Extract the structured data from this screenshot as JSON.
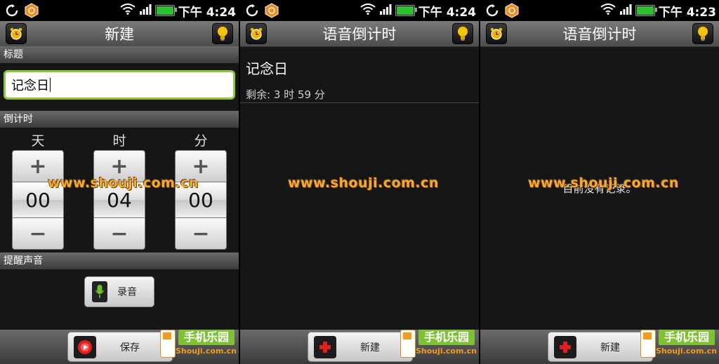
{
  "status": {
    "panel1_time": "下午 4:24",
    "panel2_time": "下午 4:24",
    "panel3_time": "下午 4:23",
    "battery_color": "#2ec02e"
  },
  "screen_new": {
    "title": "新建",
    "section_title": "标题",
    "title_value": "记念日",
    "section_countdown": "倒计时",
    "units": [
      "天",
      "时",
      "分"
    ],
    "spinners": [
      {
        "plus": "+",
        "value": "00",
        "minus": "−"
      },
      {
        "plus": "+",
        "value": "04",
        "minus": "−"
      },
      {
        "plus": "+",
        "value": "00",
        "minus": "−"
      }
    ],
    "section_sound": "提醒声音",
    "record_label": "录音",
    "save_label": "保存"
  },
  "screen_list": {
    "title": "语音倒计时",
    "entry_title": "记念日",
    "entry_remaining": "剩余: 3 时 59 分",
    "new_label": "新建"
  },
  "screen_empty": {
    "title": "语音倒计时",
    "empty_text": "目前没有记录。",
    "new_label": "新建"
  },
  "watermark": "www.shouji.com.cn",
  "logo": {
    "name": "手机乐园",
    "url": "Shouji.com.cn"
  },
  "colors": {
    "accent_green": "#8cc63f",
    "watermark": "#f4a83a",
    "bulb": "#f5c400"
  }
}
